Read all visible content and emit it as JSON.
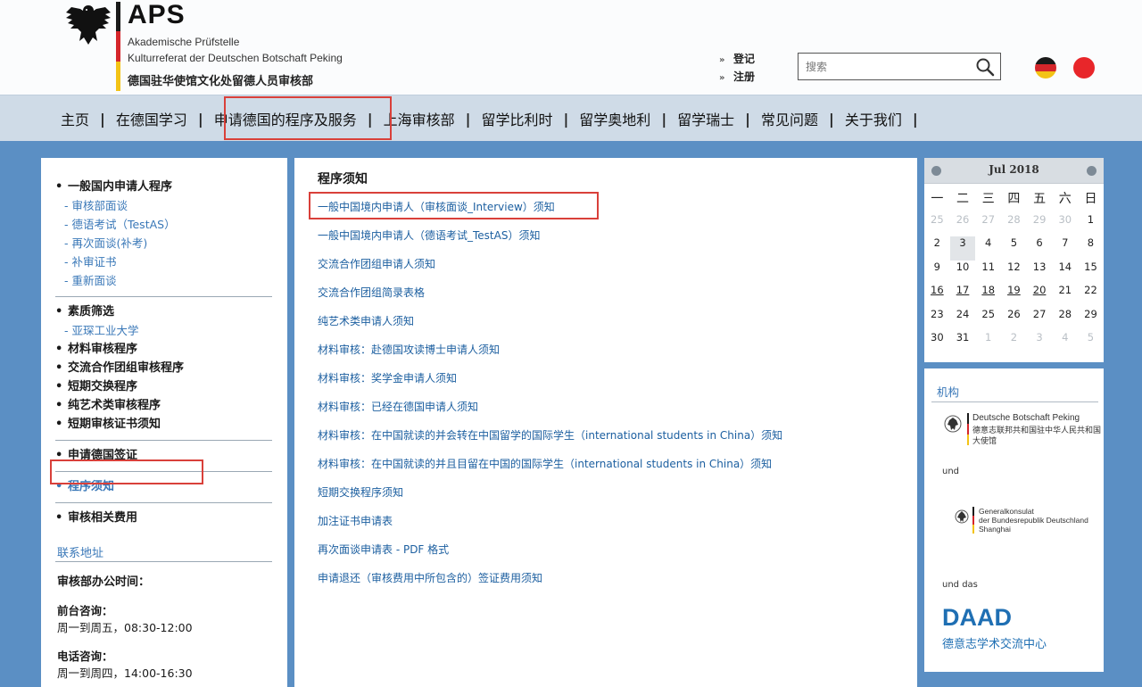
{
  "header": {
    "logo_title": "APS",
    "subtitle_1": "Akademische Prüfstelle",
    "subtitle_2": "Kulturreferat der Deutschen Botschaft Peking",
    "subtitle_3": "德国驻华使馆文化处留德人员审核部",
    "login_link": "登记",
    "register_link": "注册",
    "search_placeholder": "搜索",
    "flag_de_colors": [
      "#1a1a1a",
      "#d5262b",
      "#f3c316"
    ],
    "flag_cn_color": "#e8262a"
  },
  "nav": {
    "items": [
      "主页",
      "在德国学习",
      "申请德国的程序及服务",
      "上海审核部",
      "留学比利时",
      "留学奥地利",
      "留学瑞士",
      "常见问题",
      "关于我们"
    ],
    "separator": "|"
  },
  "sidebar": {
    "groups": [
      {
        "label": "一般国内申请人程序",
        "subs": [
          "- 审核部面谈",
          "- 德语考试（TestAS）",
          "- 再次面谈(补考)",
          "- 补审证书",
          "- 重新面谈"
        ]
      },
      {
        "label": "素质筛选",
        "subs": [
          "- 亚琛工业大学"
        ]
      }
    ],
    "items": [
      "材料审核程序",
      "交流合作团组审核程序",
      "短期交换程序",
      "纯艺术类审核程序",
      "短期审核证书须知"
    ],
    "item_visa": "申请德国签证",
    "item_guide": "程序须知",
    "item_fees": "审核相关费用"
  },
  "contact": {
    "title": "联系地址",
    "hours_title": "审核部办公时间：",
    "front_desk_label": "前台咨询：",
    "front_desk_time": "周一到周五，08:30-12:00",
    "phone_label": "电话咨询：",
    "phone_time": "周一到周四，14:00-16:30"
  },
  "main": {
    "title": "程序须知",
    "links": [
      "一般中国境内申请人（审核面谈_Interview）须知",
      "一般中国境内申请人（德语考试_TestAS）须知",
      "交流合作团组申请人须知",
      "交流合作团组简录表格",
      "纯艺术类申请人须知",
      "材料审核：赴德国攻读博士申请人须知",
      "材料审核：奖学金申请人须知",
      "材料审核：已经在德国申请人须知",
      "材料审核：在中国就读的并会转在中国留学的国际学生（international students in China）须知",
      "材料审核：在中国就读的并且目留在中国的国际学生（international students in China）须知",
      "短期交换程序须知",
      "加注证书申请表",
      "再次面谈申请表 - PDF 格式",
      "申请退还（审核费用中所包含的）签证费用须知"
    ]
  },
  "calendar": {
    "month": "Jul 2018",
    "weekdays": [
      "一",
      "二",
      "三",
      "四",
      "五",
      "六",
      "日"
    ],
    "weeks": [
      [
        "25",
        "26",
        "27",
        "28",
        "29",
        "30",
        "1"
      ],
      [
        "2",
        "3",
        "4",
        "5",
        "6",
        "7",
        "8"
      ],
      [
        "9",
        "10",
        "11",
        "12",
        "13",
        "14",
        "15"
      ],
      [
        "16",
        "17",
        "18",
        "19",
        "20",
        "21",
        "22"
      ],
      [
        "23",
        "24",
        "25",
        "26",
        "27",
        "28",
        "29"
      ],
      [
        "30",
        "31",
        "1",
        "2",
        "3",
        "4",
        "5"
      ]
    ],
    "today": "3",
    "event_days": [
      "16",
      "17",
      "18",
      "19",
      "20"
    ]
  },
  "partners": {
    "title": "机构",
    "embassy_name": "Deutsche Botschaft Peking",
    "embassy_cn_1": "德意志联邦共和国驻中华人民共和国",
    "embassy_cn_2": "大使馆",
    "and_label_1": "und",
    "consulate_1": "Generalkonsulat",
    "consulate_2": "der Bundesrepublik Deutschland",
    "consulate_3": "Shanghai",
    "and_label_2": "und das",
    "daad_logo": "DAAD",
    "daad_sub": "德意志学术交流中心"
  }
}
